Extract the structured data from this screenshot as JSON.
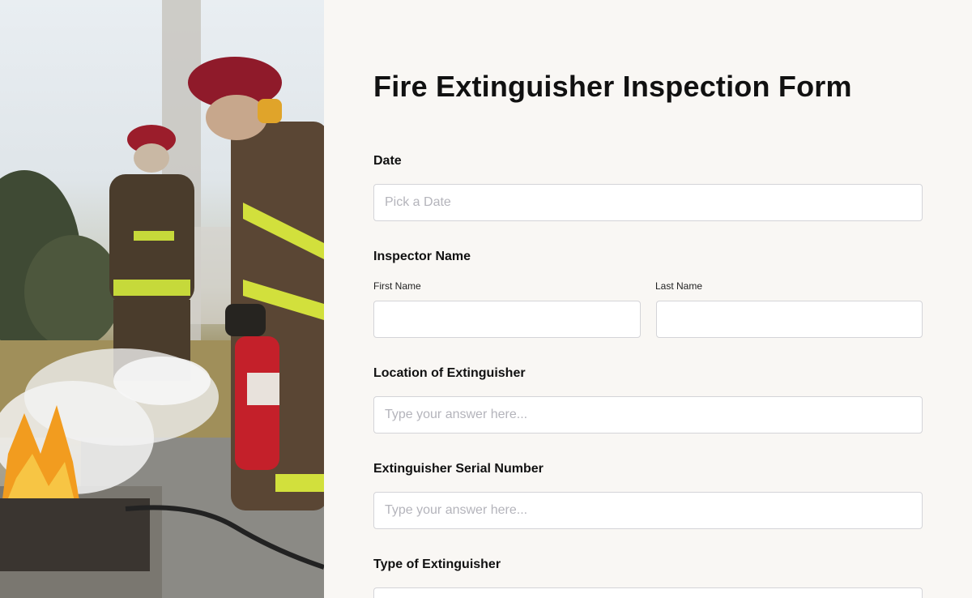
{
  "form": {
    "title": "Fire Extinguisher Inspection Form",
    "date": {
      "label": "Date",
      "placeholder": "Pick a Date"
    },
    "inspector": {
      "label": "Inspector Name",
      "first_label": "First Name",
      "last_label": "Last Name",
      "first_value": "",
      "last_value": ""
    },
    "location": {
      "label": "Location of Extinguisher",
      "placeholder": "Type your answer here..."
    },
    "serial": {
      "label": "Extinguisher Serial Number",
      "placeholder": "Type your answer here..."
    },
    "type": {
      "label": "Type of Extinguisher"
    }
  },
  "colors": {
    "background": "#f9f7f4",
    "field_border": "#d4d4d8",
    "placeholder": "#b4b4bb",
    "text": "#111111"
  },
  "icons": [
    "firefighter-photo"
  ]
}
